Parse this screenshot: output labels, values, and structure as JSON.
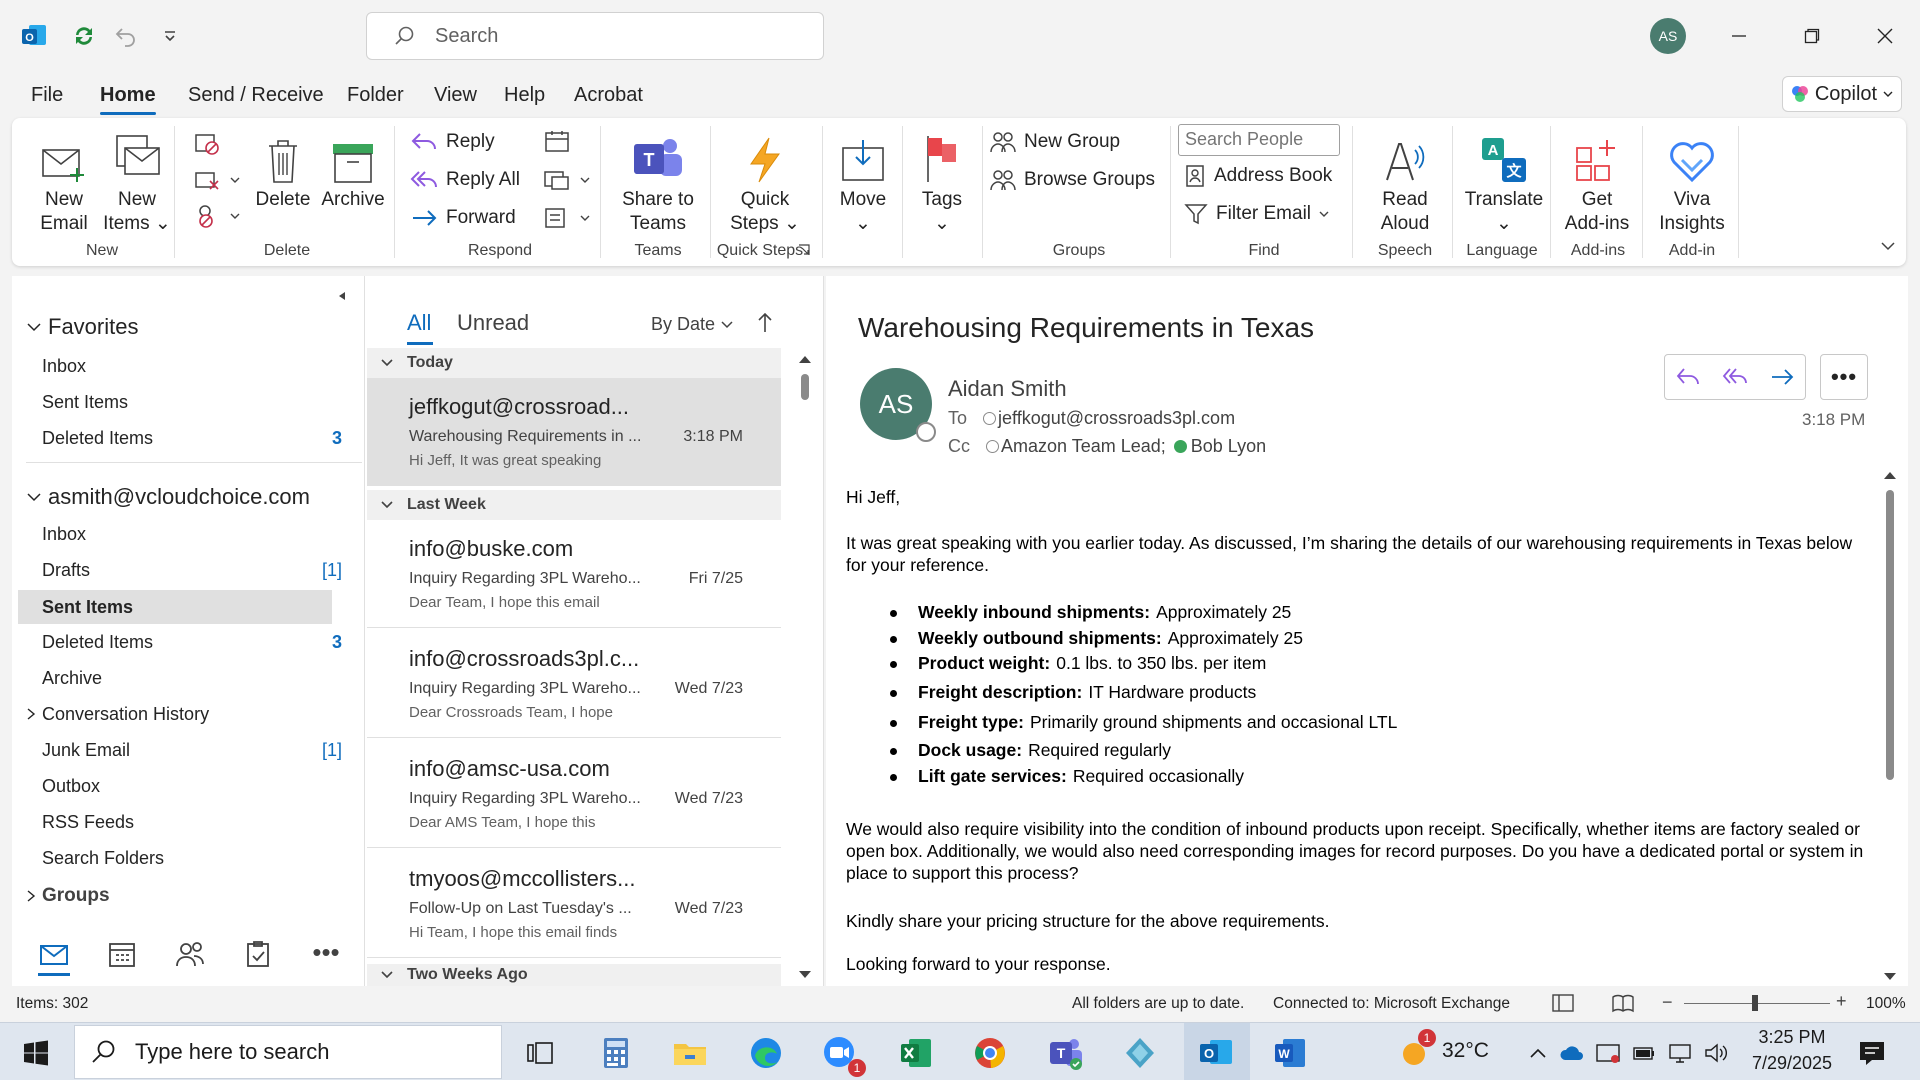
{
  "window": {
    "search_placeholder": "Search",
    "avatar_initials": "AS"
  },
  "menu": {
    "tabs": [
      "File",
      "Home",
      "Send / Receive",
      "Folder",
      "View",
      "Help",
      "Acrobat"
    ],
    "active_tab": "Home",
    "copilot": "Copilot"
  },
  "ribbon": {
    "new_email": [
      "New",
      "Email"
    ],
    "new_items": [
      "New",
      "Items"
    ],
    "delete": "Delete",
    "archive": "Archive",
    "reply": "Reply",
    "reply_all": "Reply All",
    "forward": "Forward",
    "share_to_teams": [
      "Share to",
      "Teams"
    ],
    "quick_steps": [
      "Quick",
      "Steps"
    ],
    "move": "Move",
    "tags": "Tags",
    "new_group": "New Group",
    "browse_groups": "Browse Groups",
    "search_people_placeholder": "Search People",
    "address_book": "Address Book",
    "filter_email": "Filter Email",
    "read_aloud": [
      "Read",
      "Aloud"
    ],
    "translate": "Translate",
    "get_addins": [
      "Get",
      "Add-ins"
    ],
    "viva_insights": [
      "Viva",
      "Insights"
    ],
    "groups": {
      "new": "New",
      "delete": "Delete",
      "respond": "Respond",
      "teams": "Teams",
      "quick_steps": "Quick Steps",
      "groups": "Groups",
      "find": "Find",
      "speech": "Speech",
      "language": "Language",
      "addins": "Add-ins",
      "addin": "Add-in"
    }
  },
  "nav": {
    "favorites_header": "Favorites",
    "favorites": [
      {
        "label": "Inbox",
        "count": ""
      },
      {
        "label": "Sent Items",
        "count": ""
      },
      {
        "label": "Deleted Items",
        "count": "3"
      }
    ],
    "account_header": "asmith@vcloudchoice.com",
    "folders": [
      {
        "label": "Inbox",
        "count": ""
      },
      {
        "label": "Drafts",
        "count": "[1]"
      },
      {
        "label": "Sent Items",
        "count": ""
      },
      {
        "label": "Deleted Items",
        "count": "3"
      },
      {
        "label": "Archive",
        "count": ""
      },
      {
        "label": "Conversation History",
        "count": ""
      },
      {
        "label": "Junk Email",
        "count": "[1]"
      },
      {
        "label": "Outbox",
        "count": ""
      },
      {
        "label": "RSS Feeds",
        "count": ""
      },
      {
        "label": "Search Folders",
        "count": ""
      }
    ],
    "groups_header": "Groups"
  },
  "list": {
    "filter_all": "All",
    "filter_unread": "Unread",
    "sort": "By Date",
    "groups": [
      "Today",
      "Last Week",
      "Two Weeks Ago"
    ],
    "messages": [
      {
        "from": "jeffkogut@crossroad...",
        "subject": "Warehousing Requirements in ...",
        "preview": "Hi Jeff,  It was great speaking",
        "date": "3:18 PM"
      },
      {
        "from": "info@buske.com",
        "subject": "Inquiry Regarding 3PL Wareho...",
        "preview": "Dear Team,  I hope this email",
        "date": "Fri 7/25"
      },
      {
        "from": "info@crossroads3pl.c...",
        "subject": "Inquiry Regarding 3PL Wareho...",
        "preview": "Dear Crossroads Team,  I hope",
        "date": "Wed 7/23"
      },
      {
        "from": "info@amsc-usa.com",
        "subject": "Inquiry Regarding 3PL Wareho...",
        "preview": "Dear AMS Team,  I hope this",
        "date": "Wed 7/23"
      },
      {
        "from": "tmyoos@mccollisters...",
        "subject": "Follow-Up on Last Tuesday's ...",
        "preview": "Hi Team,  I hope this email finds",
        "date": "Wed 7/23"
      }
    ]
  },
  "email": {
    "subject": "Warehousing Requirements in Texas",
    "sender_initials": "AS",
    "sender": "Aidan Smith",
    "to_label": "To",
    "to": "jeffkogut@crossroads3pl.com",
    "cc_label": "Cc",
    "cc1": "Amazon Team Lead;",
    "cc2": "Bob Lyon",
    "time": "3:18 PM",
    "greeting": "Hi Jeff,",
    "intro": "It was great speaking with you earlier today. As discussed, I’m sharing the details of our warehousing requirements in Texas below for your reference.",
    "bullets": [
      {
        "label": "Weekly inbound shipments:",
        "value": "Approximately 25"
      },
      {
        "label": "Weekly outbound shipments:",
        "value": "Approximately 25"
      },
      {
        "label": "Product weight:",
        "value": "0.1 lbs. to 350 lbs. per item"
      },
      {
        "label": "Freight description:",
        "value": "IT Hardware products"
      },
      {
        "label": "Freight type:",
        "value": "Primarily ground shipments and occasional LTL"
      },
      {
        "label": "Dock usage:",
        "value": "Required regularly"
      },
      {
        "label": "Lift gate services:",
        "value": "Required occasionally"
      }
    ],
    "para2": "We would also require visibility into the condition of inbound products upon receipt. Specifically, whether items are factory sealed or open box. Additionally, we would also need corresponding images for record purposes. Do you have a dedicated portal or system in place to support this process?",
    "para3": "Kindly share your pricing structure for the above requirements.",
    "para4": "Looking forward to your response."
  },
  "status": {
    "items": "Items: 302",
    "sync": "All folders are up to date.",
    "connection": "Connected to: Microsoft Exchange",
    "zoom": "100%"
  },
  "taskbar": {
    "search_placeholder": "Type here to search",
    "temperature": "32°C",
    "weather_badge": "1",
    "zoom_badge": "1",
    "time": "3:25 PM",
    "date": "7/29/2025"
  },
  "colors": {
    "accent": "#0f6cbd",
    "avatar_bg": "#4a7c6f",
    "selected_row": "#e0e0e0"
  }
}
